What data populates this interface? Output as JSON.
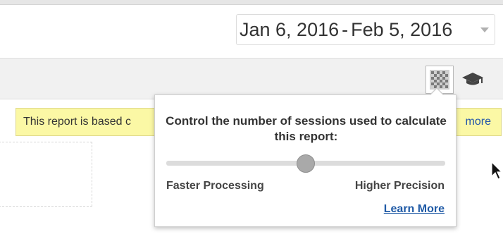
{
  "date_range": {
    "start": "Jan 6, 2016",
    "separator": "-",
    "end": "Feb 5, 2016"
  },
  "notice": {
    "text": "This report is based c",
    "link": "more"
  },
  "sampling_popover": {
    "title": "Control the number of sessions used to calculate this report:",
    "left_label": "Faster Processing",
    "right_label": "Higher Precision",
    "learn_more": "Learn More",
    "slider_position": 0.5
  },
  "icons": {
    "sampling": "sampling-grid-icon",
    "education": "graduation-cap-icon",
    "cursor": "mouse-pointer-icon"
  },
  "colors": {
    "notice_bg": "#fbf8a5",
    "link": "#1f5aa6",
    "slider_thumb": "#a9a9a9"
  }
}
